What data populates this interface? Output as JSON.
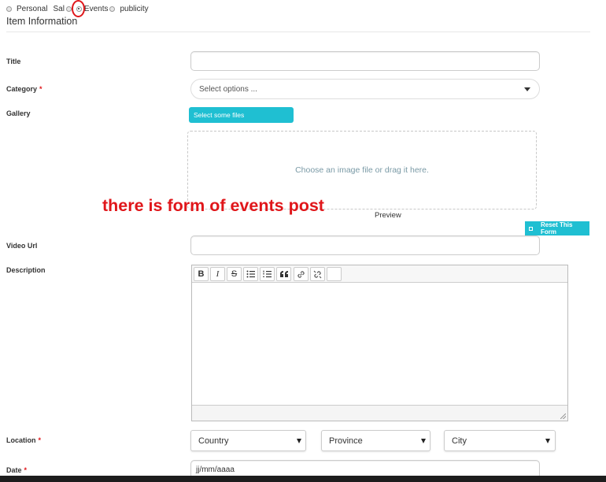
{
  "post_types": {
    "options": [
      {
        "label": "Personal",
        "checked": false
      },
      {
        "label": "Sal",
        "checked": false
      },
      {
        "label": "Events",
        "checked": true
      },
      {
        "label": "publicity",
        "checked": false
      }
    ]
  },
  "section": {
    "title": "Item Information"
  },
  "form": {
    "title_label": "Title",
    "category_label": "Category",
    "category_required": "*",
    "category_placeholder": "Select options ...",
    "gallery_label": "Gallery",
    "select_files_label": "Select some files",
    "dropzone_text": "Choose an image file or drag it here.",
    "preview_label": "Preview",
    "reset_label": "Reset This Form",
    "video_url_label": "Video Url",
    "description_label": "Description",
    "location_label": "Location",
    "location_required": "*",
    "country": "Country",
    "province": "Province",
    "city": "City",
    "date_label": "Date",
    "date_required": "*",
    "date_placeholder": "jj/mm/aaaa"
  },
  "editor_toolbar": {
    "bold": "B",
    "italic": "I",
    "strike": "S",
    "icons": [
      "bold-icon",
      "italic-icon",
      "strikethrough-icon",
      "bullet-list-icon",
      "numbered-list-icon",
      "quote-icon",
      "link-icon",
      "unlink-icon"
    ]
  },
  "annotation": {
    "text": "there  is form of events post"
  },
  "colors": {
    "accent": "#1fbfd2",
    "annotation": "#e0161a"
  }
}
